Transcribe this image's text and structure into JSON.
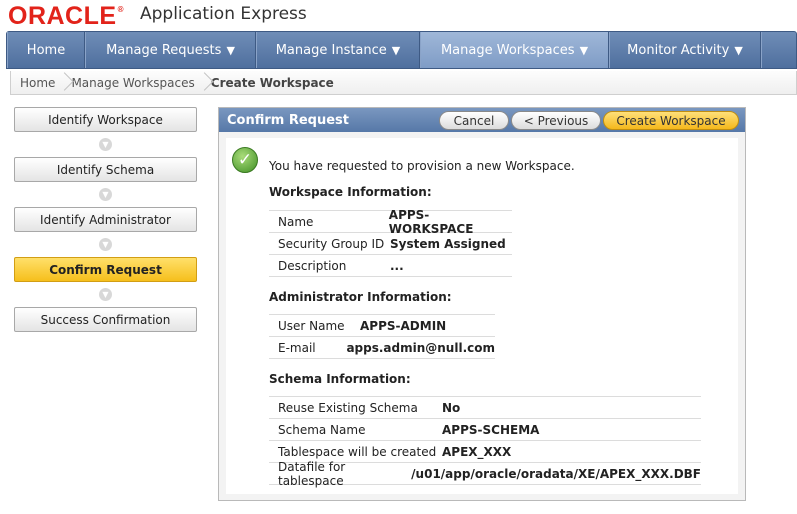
{
  "header": {
    "logo": "ORACLE",
    "app_title": "Application Express"
  },
  "nav": {
    "tabs": [
      {
        "label": "Home",
        "has_caret": false
      },
      {
        "label": "Manage Requests",
        "has_caret": true
      },
      {
        "label": "Manage Instance",
        "has_caret": true
      },
      {
        "label": "Manage Workspaces",
        "has_caret": true
      },
      {
        "label": "Monitor Activity",
        "has_caret": true
      }
    ],
    "active_tab": "Manage Workspaces",
    "caret": "▼"
  },
  "breadcrumb": {
    "items": [
      "Home",
      "Manage Workspaces"
    ],
    "current": "Create Workspace"
  },
  "wizard": {
    "steps": [
      {
        "label": "Identify Workspace"
      },
      {
        "label": "Identify Schema"
      },
      {
        "label": "Identify Administrator"
      },
      {
        "label": "Confirm Request"
      },
      {
        "label": "Success Confirmation"
      }
    ],
    "current_step": "Confirm Request",
    "arrow_icon": "chevron-down-icon"
  },
  "region": {
    "title": "Confirm Request",
    "buttons": {
      "cancel": "Cancel",
      "previous": "< Previous",
      "create": "Create Workspace"
    },
    "message": "You have requested to provision a new Workspace.",
    "success_icon": "✓",
    "workspace": {
      "title": "Workspace Information:",
      "rows": [
        {
          "label": "Name",
          "value": "APPS-WORKSPACE"
        },
        {
          "label": "Security Group ID",
          "value": "System Assigned"
        },
        {
          "label": "Description",
          "value": "..."
        }
      ]
    },
    "administrator": {
      "title": "Administrator Information:",
      "rows": [
        {
          "label": "User Name",
          "value": "APPS-ADMIN"
        },
        {
          "label": "E-mail",
          "value": "apps.admin@null.com"
        }
      ]
    },
    "schema": {
      "title": "Schema Information:",
      "rows": [
        {
          "label": "Reuse Existing Schema",
          "value": "No"
        },
        {
          "label": "Schema Name",
          "value": "APPS-SCHEMA"
        },
        {
          "label": "Tablespace will be created",
          "value": "APEX_XXX"
        },
        {
          "label": "Datafile for tablespace",
          "value": "/u01/app/oracle/oradata/XE/APEX_XXX.DBF"
        }
      ]
    }
  },
  "colors": {
    "oracle_red": "#e2231a",
    "nav_blue": "#5678a8",
    "highlight_yellow": "#f6bf1c",
    "success_green": "#3f8f24"
  }
}
